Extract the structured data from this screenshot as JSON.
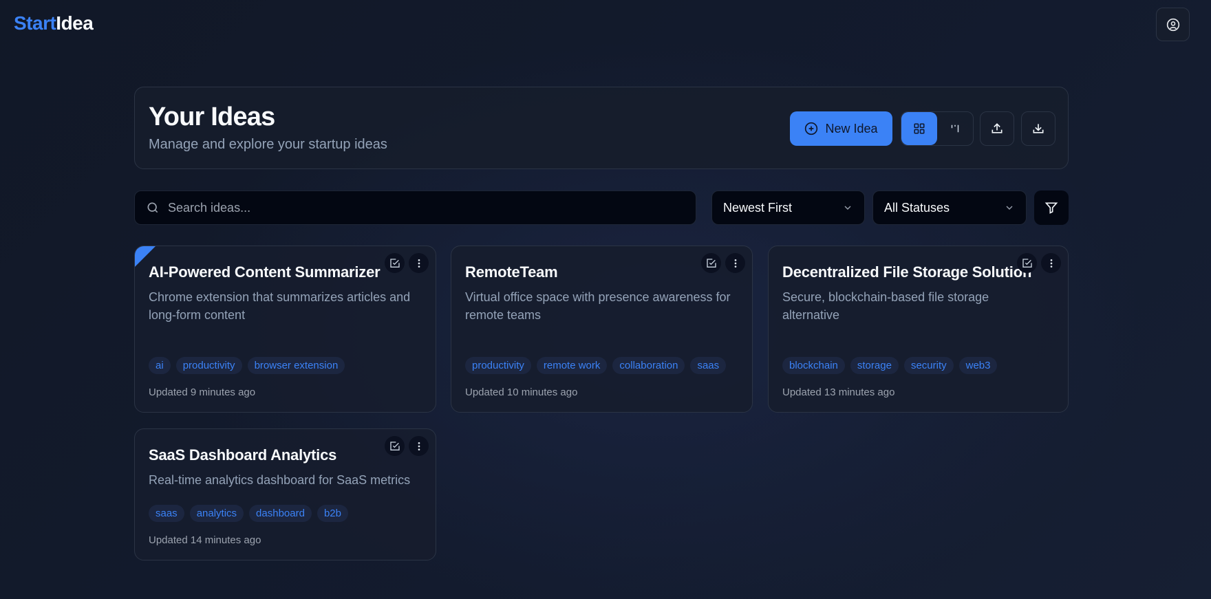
{
  "app": {
    "logo_start": "Start",
    "logo_end": "Idea"
  },
  "header": {
    "title": "Your Ideas",
    "subtitle": "Manage and explore your startup ideas",
    "new_idea_label": "New Idea"
  },
  "search": {
    "placeholder": "Search ideas...",
    "value": ""
  },
  "sort": {
    "selected": "Newest First"
  },
  "status_filter": {
    "selected": "All Statuses"
  },
  "colors": {
    "accent": "#3b82f6",
    "background": "#111827"
  },
  "ideas": [
    {
      "title": "AI-Powered Content Summarizer",
      "description": "Chrome extension that summarizes articles and long-form content",
      "tags": [
        "ai",
        "productivity",
        "browser extension"
      ],
      "updated": "Updated 9 minutes ago",
      "highlighted": true
    },
    {
      "title": "RemoteTeam",
      "description": "Virtual office space with presence awareness for remote teams",
      "tags": [
        "productivity",
        "remote work",
        "collaboration",
        "saas"
      ],
      "updated": "Updated 10 minutes ago"
    },
    {
      "title": "Decentralized File Storage Solution",
      "description": "Secure, blockchain-based file storage alternative",
      "tags": [
        "blockchain",
        "storage",
        "security",
        "web3"
      ],
      "updated": "Updated 13 minutes ago"
    },
    {
      "title": "SaaS Dashboard Analytics",
      "description": "Real-time analytics dashboard for SaaS metrics",
      "tags": [
        "saas",
        "analytics",
        "dashboard",
        "b2b"
      ],
      "updated": "Updated 14 minutes ago"
    }
  ]
}
